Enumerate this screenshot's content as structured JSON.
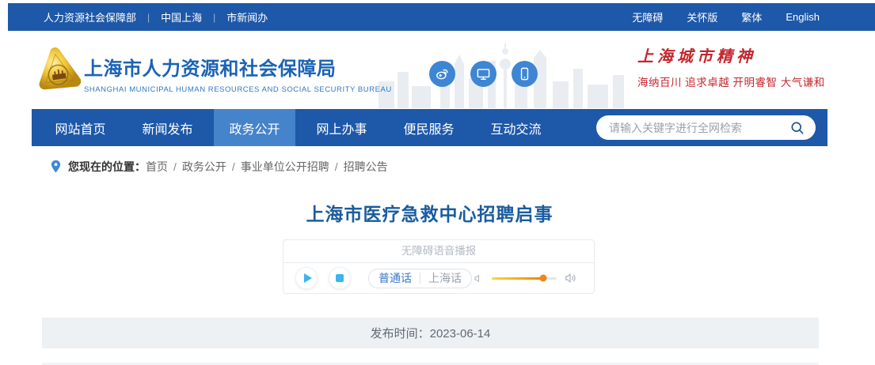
{
  "topbar": {
    "separator": "|",
    "left_links": [
      {
        "label": "人力资源社会保障部"
      },
      {
        "label": "中国上海"
      },
      {
        "label": "市新闻办"
      }
    ],
    "right_links": [
      {
        "label": "无障碍"
      },
      {
        "label": "关怀版"
      },
      {
        "label": "繁体"
      },
      {
        "label": "English"
      }
    ]
  },
  "header": {
    "site_title": "上海市人力资源和社会保障局",
    "site_subtitle": "SHANGHAI MUNICIPAL HUMAN RESOURCES AND SOCIAL SECURITY BUREAU",
    "slogan_title": "上海城市精神",
    "slogan_sub": "海纳百川  追求卓越  开明睿智  大气谦和",
    "icons": [
      "weibo-icon",
      "desktop-icon",
      "mobile-icon"
    ]
  },
  "nav": {
    "items": [
      {
        "label": "网站首页",
        "active": false
      },
      {
        "label": "新闻发布",
        "active": false
      },
      {
        "label": "政务公开",
        "active": true
      },
      {
        "label": "网上办事",
        "active": false
      },
      {
        "label": "便民服务",
        "active": false
      },
      {
        "label": "互动交流",
        "active": false
      }
    ],
    "search_placeholder": "请输入关键字进行全网检索"
  },
  "breadcrumb": {
    "label": "您现在的位置：",
    "separator": "/",
    "items": [
      {
        "label": "首页"
      },
      {
        "label": "政务公开"
      },
      {
        "label": "事业单位公开招聘"
      },
      {
        "label": "招聘公告"
      }
    ]
  },
  "article": {
    "title": "上海市医疗急救中心招聘启事",
    "publish_text": "发布时间：2023-06-14"
  },
  "player": {
    "header": "无障碍语音播报",
    "lang_mandarin": "普通话",
    "lang_shanghainese": "上海话",
    "volume_percent": 79
  },
  "colors": {
    "primary_blue": "#1d58a9",
    "active_nav_blue": "#4583cb",
    "logo_blue": "#1b63b5",
    "title_blue": "#1a5c9e",
    "slogan_red": "#c4272e",
    "player_cyan": "#3ab5ef",
    "volume_orange": "#f08300",
    "publish_bar_gray": "#eef1f4"
  }
}
